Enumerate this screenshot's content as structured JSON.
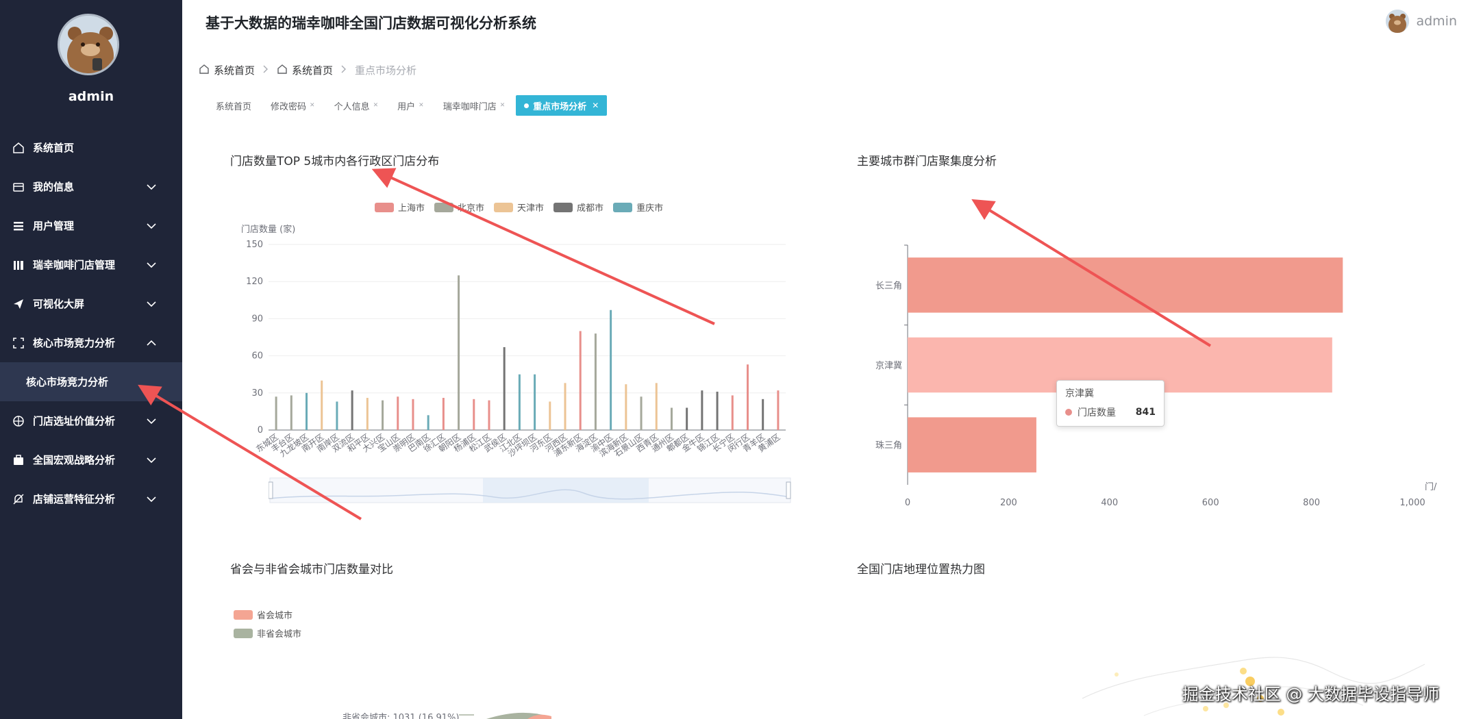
{
  "app": {
    "title": "基于大数据的瑞幸咖啡全国门店数据可视化分析系统",
    "user": "admin"
  },
  "sidebar": {
    "user": "admin",
    "items": [
      {
        "label": "系统首页",
        "icon": "home-icon",
        "expandable": false
      },
      {
        "label": "我的信息",
        "icon": "wallet-icon",
        "expandable": true
      },
      {
        "label": "用户管理",
        "icon": "list-icon",
        "expandable": true
      },
      {
        "label": "瑞幸咖啡门店管理",
        "icon": "library-icon",
        "expandable": true
      },
      {
        "label": "可视化大屏",
        "icon": "send-icon",
        "expandable": true
      },
      {
        "label": "核心市场竞力分析",
        "icon": "crop-icon",
        "expandable": true,
        "expanded": true
      },
      {
        "label": "门店选址价值分析",
        "icon": "compass-icon",
        "expandable": true
      },
      {
        "label": "全国宏观战略分析",
        "icon": "briefcase-icon",
        "expandable": true
      },
      {
        "label": "店铺运营特征分析",
        "icon": "bell-off-icon",
        "expandable": true
      }
    ],
    "sub_item": "核心市场竞力分析"
  },
  "breadcrumb": [
    "系统首页",
    "系统首页",
    "重点市场分析"
  ],
  "tabs": [
    {
      "label": "系统首页",
      "closable": false,
      "active": false
    },
    {
      "label": "修改密码",
      "closable": true,
      "active": false
    },
    {
      "label": "个人信息",
      "closable": true,
      "active": false
    },
    {
      "label": "用户",
      "closable": true,
      "active": false
    },
    {
      "label": "瑞幸咖啡门店",
      "closable": true,
      "active": false
    },
    {
      "label": "重点市场分析",
      "closable": true,
      "active": true
    }
  ],
  "panels": {
    "p1": "门店数量TOP 5城市内各行政区门店分布",
    "p2": "主要城市群门店聚集度分析",
    "p3": "省会与非省会城市门店数量对比",
    "p4": "全国门店地理位置热力图"
  },
  "colors": {
    "sidebar_bg": "#1f2538",
    "active_tab": "#33b5d6",
    "shanghai": "#e88f8b",
    "beijing": "#a5a89b",
    "tianjin": "#ecc495",
    "chengdu": "#747474",
    "chongqing": "#6aabb7",
    "bar_salmon": "#f19a8d",
    "bar_pink": "#fbb6ae",
    "capital": "#f4a593",
    "non_capital": "#a9b3a0"
  },
  "chart_data": [
    {
      "type": "bar",
      "title": "门店数量TOP 5城市内各行政区门店分布",
      "ylabel": "门店数量 (家)",
      "ylim": [
        0,
        150
      ],
      "yticks": [
        0,
        30,
        60,
        90,
        120,
        150
      ],
      "legend": [
        "上海市",
        "北京市",
        "天津市",
        "成都市",
        "重庆市"
      ],
      "categories": [
        "东城区",
        "丰台区",
        "九龙坡区",
        "南开区",
        "南岸区",
        "双流区",
        "和平区",
        "大兴区",
        "宝山区",
        "崇明区",
        "巴南区",
        "徐汇区",
        "朝阳区",
        "杨浦区",
        "松江区",
        "武侯区",
        "江北区",
        "沙坪坝区",
        "河东区",
        "河西区",
        "浦东新区",
        "海淀区",
        "渝中区",
        "滨海新区",
        "石景山区",
        "西青区",
        "通州区",
        "郫都区",
        "金牛区",
        "锦江区",
        "长宁区",
        "闵行区",
        "青羊区",
        "黄浦区"
      ],
      "bars": [
        {
          "series": "北京市",
          "value": 27
        },
        {
          "series": "北京市",
          "value": 28
        },
        {
          "series": "重庆市",
          "value": 30
        },
        {
          "series": "天津市",
          "value": 40
        },
        {
          "series": "重庆市",
          "value": 23
        },
        {
          "series": "成都市",
          "value": 32
        },
        {
          "series": "天津市",
          "value": 26
        },
        {
          "series": "北京市",
          "value": 24
        },
        {
          "series": "上海市",
          "value": 27
        },
        {
          "series": "上海市",
          "value": 25
        },
        {
          "series": "重庆市",
          "value": 12
        },
        {
          "series": "上海市",
          "value": 26
        },
        {
          "series": "北京市",
          "value": 125
        },
        {
          "series": "上海市",
          "value": 25
        },
        {
          "series": "上海市",
          "value": 24
        },
        {
          "series": "成都市",
          "value": 67
        },
        {
          "series": "重庆市",
          "value": 45
        },
        {
          "series": "重庆市",
          "value": 45
        },
        {
          "series": "天津市",
          "value": 23
        },
        {
          "series": "天津市",
          "value": 38
        },
        {
          "series": "上海市",
          "value": 80
        },
        {
          "series": "北京市",
          "value": 78
        },
        {
          "series": "重庆市",
          "value": 97
        },
        {
          "series": "天津市",
          "value": 37
        },
        {
          "series": "北京市",
          "value": 27
        },
        {
          "series": "天津市",
          "value": 38
        },
        {
          "series": "北京市",
          "value": 18
        },
        {
          "series": "成都市",
          "value": 18
        },
        {
          "series": "成都市",
          "value": 32
        },
        {
          "series": "成都市",
          "value": 31
        },
        {
          "series": "上海市",
          "value": 28
        },
        {
          "series": "上海市",
          "value": 53
        },
        {
          "series": "成都市",
          "value": 25
        },
        {
          "series": "上海市",
          "value": 32
        }
      ]
    },
    {
      "type": "bar",
      "orientation": "horizontal",
      "title": "主要城市群门店聚集度分析",
      "xlabel": "门/",
      "xlim": [
        0,
        1000
      ],
      "xticks": [
        "0",
        "200",
        "400",
        "600",
        "800",
        "1,000"
      ],
      "categories": [
        "长三角",
        "京津冀",
        "珠三角"
      ],
      "values": [
        862,
        841,
        255
      ],
      "tooltip": {
        "category": "京津冀",
        "series": "门店数量",
        "value": 841
      }
    },
    {
      "type": "pie",
      "title": "省会与非省会城市门店数量对比",
      "legend": [
        "省会城市",
        "非省会城市"
      ],
      "label_visible": "非省会城市: 1031 (16.91%)"
    }
  ],
  "watermark": "掘金技术社区 @ 大数据毕设指导师"
}
